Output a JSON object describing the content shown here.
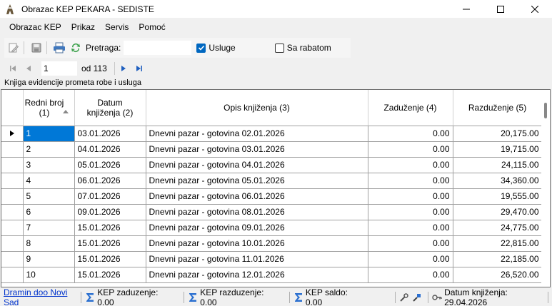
{
  "window": {
    "title": "Obrazac KEP PEKARA - SEDISTE"
  },
  "menu": {
    "items": [
      "Obrazac KEP",
      "Prikaz",
      "Servis",
      "Pomoć"
    ]
  },
  "toolbar": {
    "search_label": "Pretraga:",
    "search_value": "",
    "usluge_label": "Usluge",
    "usluge_checked": true,
    "rabat_label": "Sa rabatom",
    "rabat_checked": false
  },
  "navigator": {
    "position": "1",
    "of_label": "od 113"
  },
  "grid": {
    "caption": "Knjiga evidencije prometa robe i usluga",
    "columns": [
      "Redni broj (1)",
      "Datum knjiženja (2)",
      "Opis knjiženja (3)",
      "Zaduženje (4)",
      "Razduženje (5)"
    ],
    "rows": [
      [
        "1",
        "03.01.2026",
        "Dnevni pazar - gotovina 02.01.2026",
        "0.00",
        "20,175.00"
      ],
      [
        "2",
        "04.01.2026",
        "Dnevni pazar - gotovina 03.01.2026",
        "0.00",
        "19,715.00"
      ],
      [
        "3",
        "05.01.2026",
        "Dnevni pazar - gotovina 04.01.2026",
        "0.00",
        "24,115.00"
      ],
      [
        "4",
        "06.01.2026",
        "Dnevni pazar - gotovina 05.01.2026",
        "0.00",
        "34,360.00"
      ],
      [
        "5",
        "07.01.2026",
        "Dnevni pazar - gotovina 06.01.2026",
        "0.00",
        "19,555.00"
      ],
      [
        "6",
        "09.01.2026",
        "Dnevni pazar - gotovina 08.01.2026",
        "0.00",
        "29,470.00"
      ],
      [
        "7",
        "15.01.2026",
        "Dnevni pazar - gotovina 09.01.2026",
        "0.00",
        "24,775.00"
      ],
      [
        "8",
        "15.01.2026",
        "Dnevni pazar - gotovina 10.01.2026",
        "0.00",
        "22,815.00"
      ],
      [
        "9",
        "15.01.2026",
        "Dnevni pazar - gotovina 11.01.2026",
        "0.00",
        "22,185.00"
      ],
      [
        "10",
        "15.01.2026",
        "Dnevni pazar - gotovina 12.01.2026",
        "0.00",
        "26,520.00"
      ]
    ]
  },
  "status": {
    "company": "Dramin doo Novi Sad",
    "zaduzenje": "KEP zaduzenje: 0.00",
    "razduzenje": "KEP razduzenje: 0.00",
    "saldo": "KEP saldo: 0.00",
    "datum": "Datum knjiženja: 29.04.2026"
  },
  "colors": {
    "selection": "#0078d7",
    "link": "#0033cc",
    "checkbox": "#0067c0"
  }
}
